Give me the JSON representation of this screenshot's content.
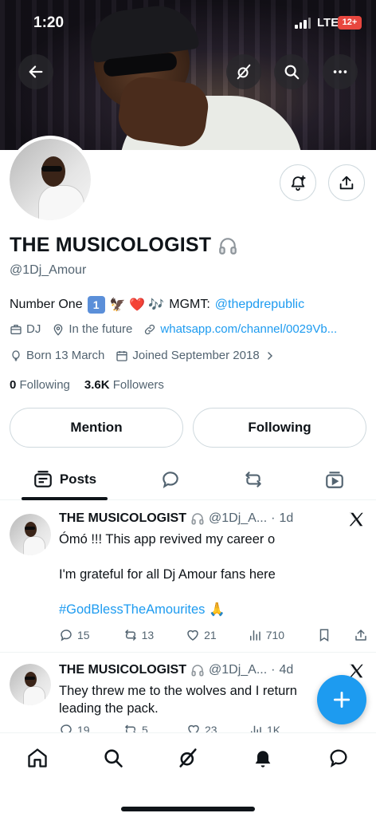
{
  "status_bar": {
    "time": "1:20",
    "network": "LTE",
    "battery": "12+"
  },
  "profile": {
    "name": "THE MUSICOLOGIST",
    "handle": "@1Dj_Amour",
    "bio": {
      "prefix": "Number One",
      "number_emoji": "1",
      "emoji": "🦅 ❤️ 🎶",
      "mgmt_label": "MGMT:",
      "mgmt_link": "@thepdrepublic"
    },
    "category": "DJ",
    "location": "In the future",
    "website": "whatsapp.com/channel/0029Vb...",
    "born": "Born 13 March",
    "joined": "Joined September 2018",
    "following_count": "0",
    "following_label": "Following",
    "followers_count": "3.6K",
    "followers_label": "Followers"
  },
  "buttons": {
    "mention": "Mention",
    "following": "Following"
  },
  "tabs": [
    {
      "label": "Posts",
      "icon": "posts-icon"
    },
    {
      "icon": "replies-icon"
    },
    {
      "icon": "reposts-icon"
    },
    {
      "icon": "media-icon"
    }
  ],
  "posts": [
    {
      "author": "THE MUSICOLOGIST",
      "handle": "@1Dj_A...",
      "time": "1d",
      "lines": [
        "Ómó !!! This app revived my career o",
        "I'm grateful for all Dj Amour fans here"
      ],
      "hashtag": "#GodBlessTheAmourites",
      "hashtag_emoji": "🙏",
      "replies": "15",
      "reposts": "13",
      "likes": "21",
      "views": "710"
    },
    {
      "author": "THE MUSICOLOGIST",
      "handle": "@1Dj_A...",
      "time": "4d",
      "lines": [
        "They threw me to the wolves and I return",
        "leading the pack."
      ],
      "replies": "19",
      "reposts": "5",
      "likes": "23",
      "views": "1K"
    }
  ],
  "colors": {
    "accent": "#1d9bf0",
    "text": "#0f1419",
    "muted": "#536471",
    "border": "#cfd9de"
  }
}
